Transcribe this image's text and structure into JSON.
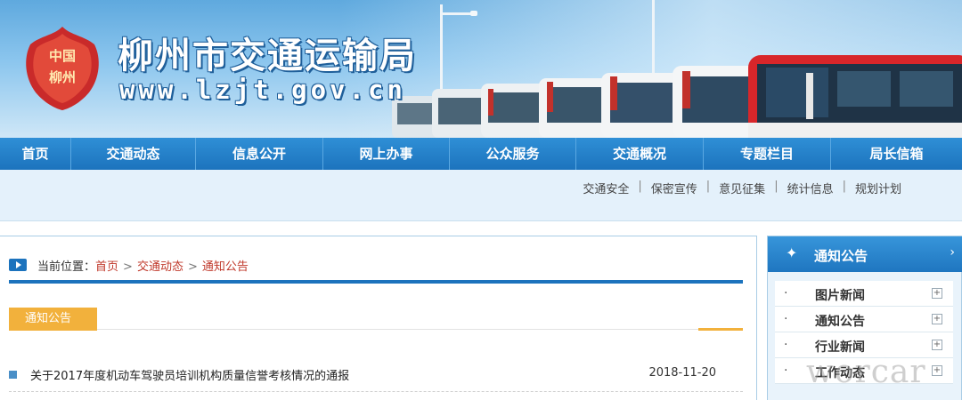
{
  "header": {
    "emblem_text": "中国柳州",
    "title": "柳州市交通运输局",
    "url": "www.lzjt.gov.cn"
  },
  "nav": {
    "items": [
      {
        "label": "首页"
      },
      {
        "label": "交通动态"
      },
      {
        "label": "信息公开"
      },
      {
        "label": "网上办事"
      },
      {
        "label": "公众服务"
      },
      {
        "label": "交通概况"
      },
      {
        "label": "专题栏目"
      },
      {
        "label": "局长信箱"
      }
    ]
  },
  "sublinks": [
    "交通安全",
    "保密宣传",
    "意见征集",
    "统计信息",
    "规划计划"
  ],
  "breadcrumb": {
    "prefix": "当前位置：",
    "items": [
      "首页",
      "交通动态",
      "通知公告"
    ]
  },
  "section": {
    "title": "通知公告"
  },
  "news": [
    {
      "title": "关于2017年度机动车驾驶员培训机构质量信誉考核情况的通报",
      "date": "2018-11-20"
    }
  ],
  "sidebar": {
    "title": "通知公告",
    "items": [
      {
        "label": "图片新闻"
      },
      {
        "label": "通知公告"
      },
      {
        "label": "行业新闻"
      },
      {
        "label": "工作动态"
      }
    ]
  },
  "watermark": "worcar",
  "colors": {
    "nav_blue": "#1c73bd",
    "accent_orange": "#f2b13c",
    "crumb_red": "#c0392b"
  }
}
